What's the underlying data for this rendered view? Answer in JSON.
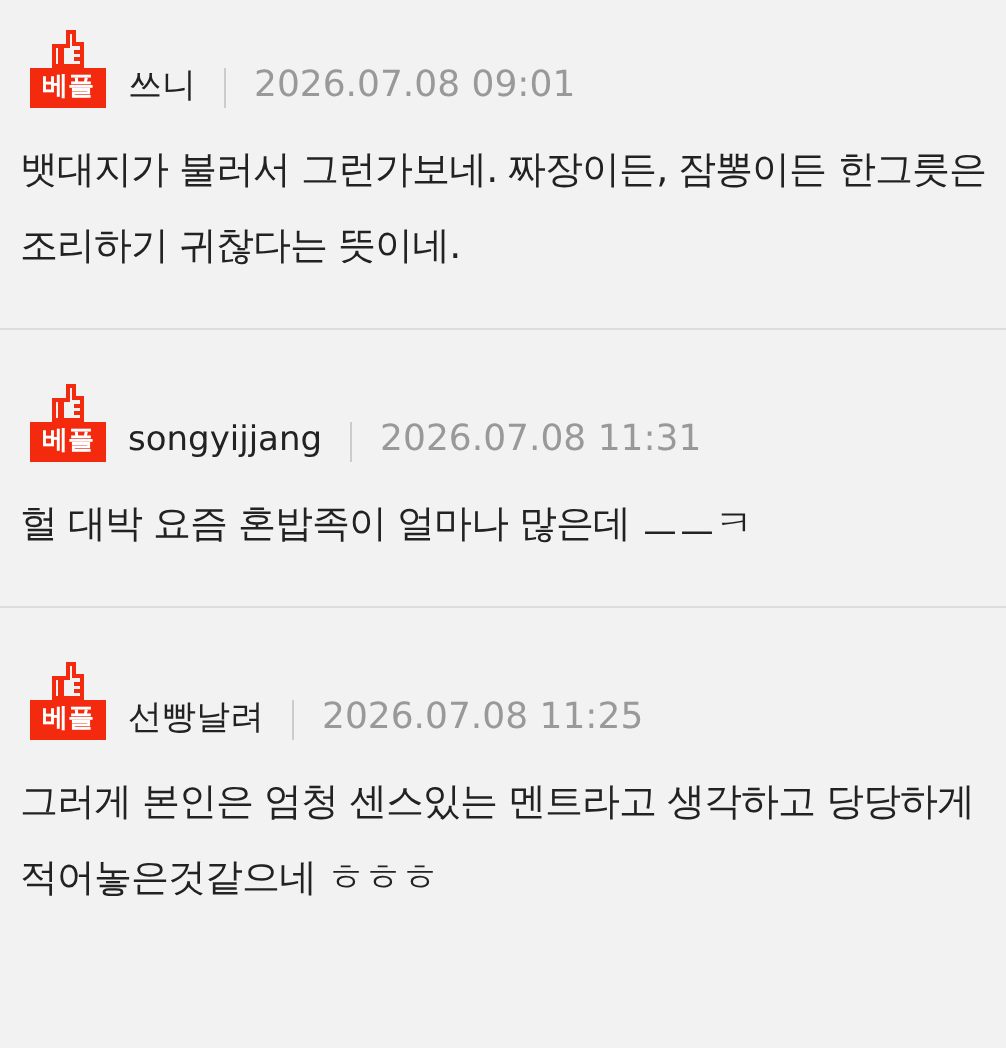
{
  "comments": [
    {
      "badge": "베플",
      "author": "쓰니",
      "date": "2026.07.08 09:01",
      "text": "뱃대지가 불러서 그런가보네. 짜장이든, 잠뽕이든 한그릇은 조리하기 귀찮다는 뜻이네."
    },
    {
      "badge": "베플",
      "author": "songyijjang",
      "date": "2026.07.08 11:31",
      "text": "헐 대박 요즘 혼밥족이 얼마나 많은데 ㅡㅡㅋ"
    },
    {
      "badge": "베플",
      "author": "선빵날려",
      "date": "2026.07.08 11:25",
      "text": "그러게 본인은 엄청 센스있는 멘트라고 생각하고 당당하게 적어놓은것같으네 ㅎㅎㅎ"
    }
  ]
}
